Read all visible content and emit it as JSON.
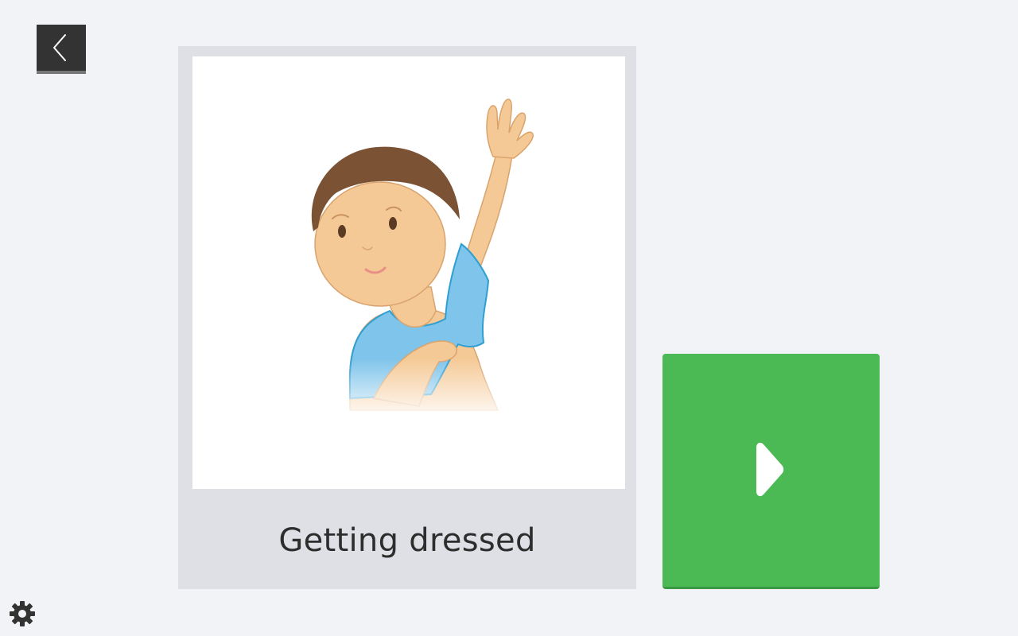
{
  "header": {
    "back_icon": "chevron-left-icon"
  },
  "card": {
    "label": "Getting dressed",
    "image_icon": "child-getting-dressed-illustration"
  },
  "controls": {
    "play_icon": "play-icon",
    "settings_icon": "gear-icon"
  },
  "colors": {
    "background": "#f2f3f7",
    "card_background": "#dfe0e5",
    "play_button": "#4bb954",
    "back_button": "#333333"
  }
}
